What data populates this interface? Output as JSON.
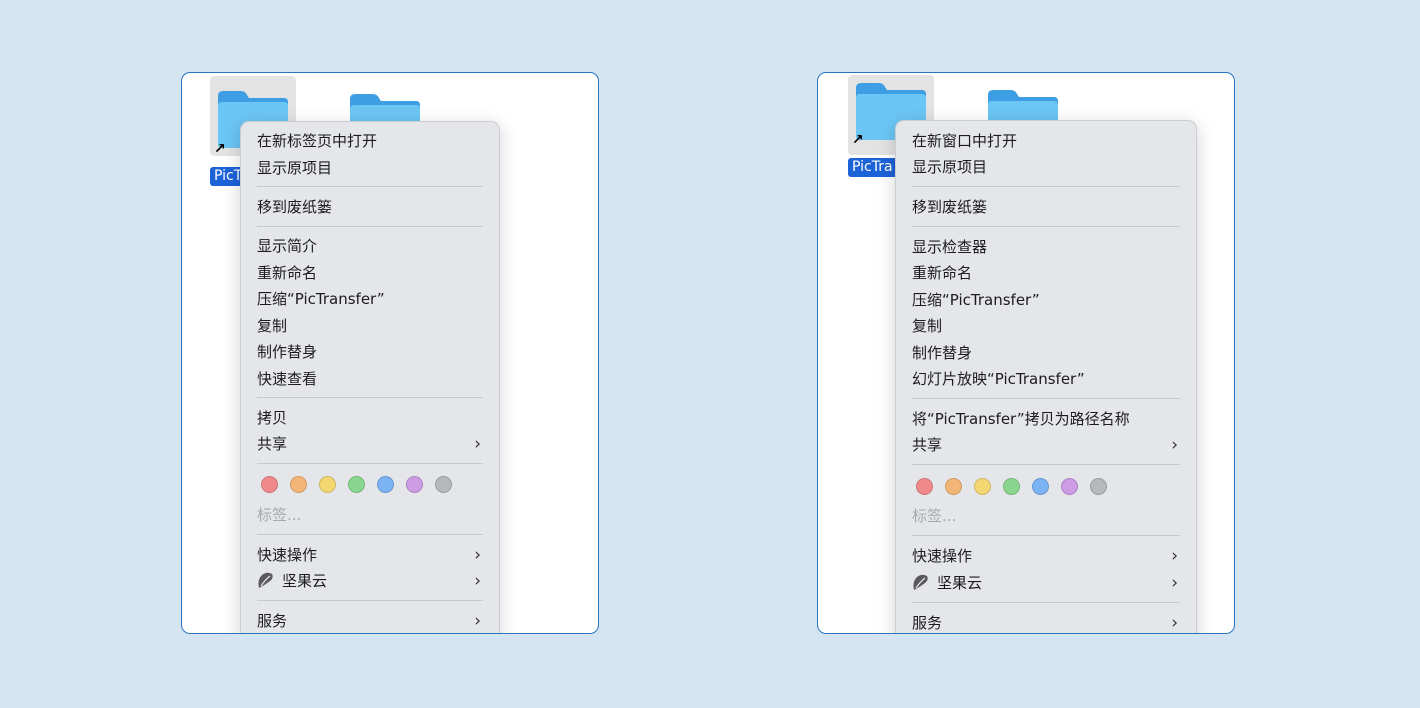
{
  "colors": {
    "background": "#d4e5f1",
    "panel_border": "#2b74c0",
    "selection": "#1d63d8",
    "folder": "#6cc6f5"
  },
  "left": {
    "file_label": "PicT",
    "menu": {
      "open_in_tab": "在新标签页中打开",
      "show_original": "显示原项目",
      "move_to_trash": "移到废纸篓",
      "get_info": "显示简介",
      "rename": "重新命名",
      "compress": "压缩“PicTransfer”",
      "duplicate": "复制",
      "make_alias": "制作替身",
      "quick_look": "快速查看",
      "copy": "拷贝",
      "share": "共享",
      "tags": "标签...",
      "quick_actions": "快速操作",
      "jianguoyun": "坚果云",
      "services": "服务"
    }
  },
  "right": {
    "file_label": "PicTra",
    "menu": {
      "open_in_window": "在新窗口中打开",
      "show_original": "显示原项目",
      "move_to_trash": "移到废纸篓",
      "show_inspector": "显示检查器",
      "rename": "重新命名",
      "compress": "压缩“PicTransfer”",
      "duplicate": "复制",
      "make_alias": "制作替身",
      "slideshow": "幻灯片放映“PicTransfer”",
      "copy_as_path": "将“PicTransfer”拷贝为路径名称",
      "share": "共享",
      "tags": "标签...",
      "quick_actions": "快速操作",
      "jianguoyun": "坚果云",
      "services": "服务"
    }
  },
  "tag_colors": [
    {
      "name": "red",
      "color": "#f08a8a"
    },
    {
      "name": "orange",
      "color": "#f4b677"
    },
    {
      "name": "yellow",
      "color": "#f3d872"
    },
    {
      "name": "green",
      "color": "#8bd68e"
    },
    {
      "name": "blue",
      "color": "#7bb3f5"
    },
    {
      "name": "purple",
      "color": "#cc9ce4"
    },
    {
      "name": "gray",
      "color": "#b6b8bb"
    }
  ]
}
